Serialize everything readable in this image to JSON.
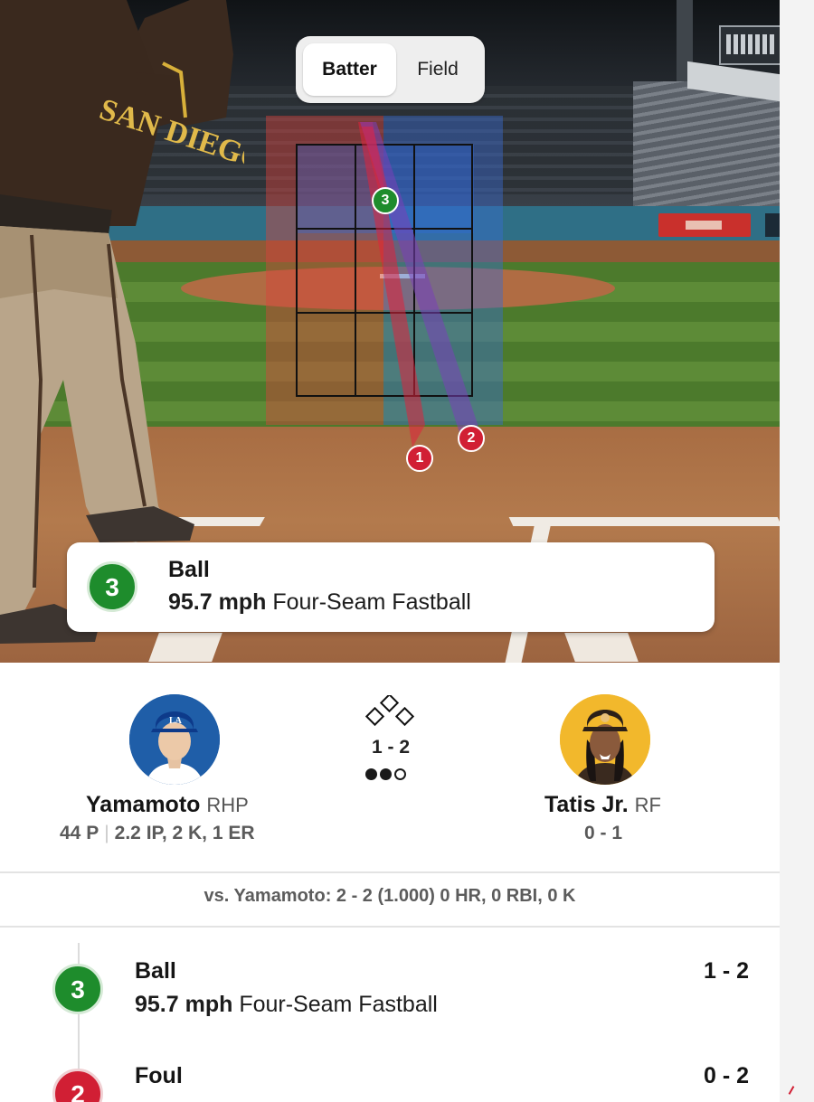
{
  "toggle": {
    "batter_label": "Batter",
    "field_label": "Field",
    "selected": "Batter"
  },
  "field_view": {
    "jersey_text": "SAN DIEGO",
    "logo_partial": "M",
    "pitch_markers": [
      {
        "number": "1",
        "color": "#d11f34"
      },
      {
        "number": "2",
        "color": "#d11f34"
      },
      {
        "number": "3",
        "color": "#1e8c2c"
      }
    ]
  },
  "current_pitch": {
    "number": "3",
    "result": "Ball",
    "speed": "95.7 mph",
    "pitch_type": "Four-Seam Fastball",
    "color": "#1e8c2c"
  },
  "matchup": {
    "pitcher": {
      "name": "Yamamoto",
      "position": "RHP",
      "pitches": "44 P",
      "line": "2.2 IP, 2 K, 1 ER",
      "team_color": "#1f5ea8"
    },
    "count": "1 - 2",
    "outs_filled": 2,
    "outs_total": 3,
    "batter": {
      "name": "Tatis Jr.",
      "position": "RF",
      "line": "0 - 1",
      "team_color": "#f2b82c"
    },
    "vs_line": "vs. Yamamoto: 2 - 2 (1.000) 0 HR, 0 RBI, 0 K"
  },
  "pitch_log": [
    {
      "number": "3",
      "result": "Ball",
      "speed": "95.7 mph",
      "pitch_type": "Four-Seam Fastball",
      "count": "1 - 2",
      "color": "#1e8c2c"
    },
    {
      "number": "2",
      "result": "Foul",
      "count": "0 - 2",
      "color": "#d11f34"
    }
  ]
}
